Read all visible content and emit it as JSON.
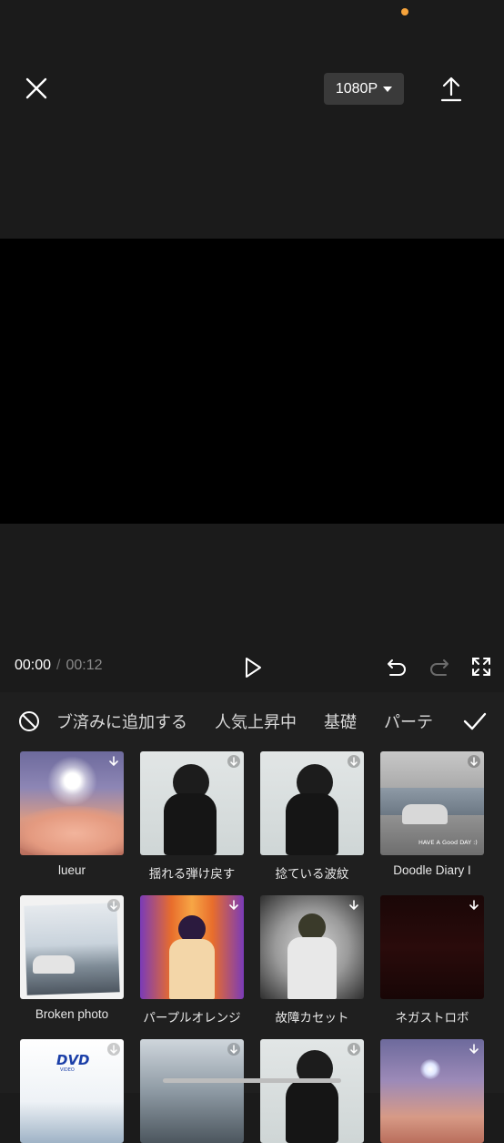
{
  "header": {
    "resolution": "1080P"
  },
  "player": {
    "current_time": "00:00",
    "separator": "/",
    "total_time": "00:12"
  },
  "tabs": [
    "ブ済みに追加する",
    "人気上昇中",
    "基礎",
    "パーテ"
  ],
  "effects": [
    {
      "label": "lueur"
    },
    {
      "label": "揺れる弾け戻す"
    },
    {
      "label": "捻ている波紋"
    },
    {
      "label": "Doodle Diary I"
    },
    {
      "label": "Broken photo"
    },
    {
      "label": "パープルオレンジ"
    },
    {
      "label": "故障カセット"
    },
    {
      "label": "ネガストロボ"
    },
    {
      "label": ""
    },
    {
      "label": ""
    },
    {
      "label": ""
    },
    {
      "label": ""
    }
  ],
  "thumb_texts": {
    "doodle": "HAVE A Good DAY :)",
    "dvd": "DVD",
    "dvd_sub": "VIDEO"
  },
  "colors": {
    "accent_dot": "#f5a33b",
    "background": "#1b1b1b",
    "preview": "#000000"
  }
}
